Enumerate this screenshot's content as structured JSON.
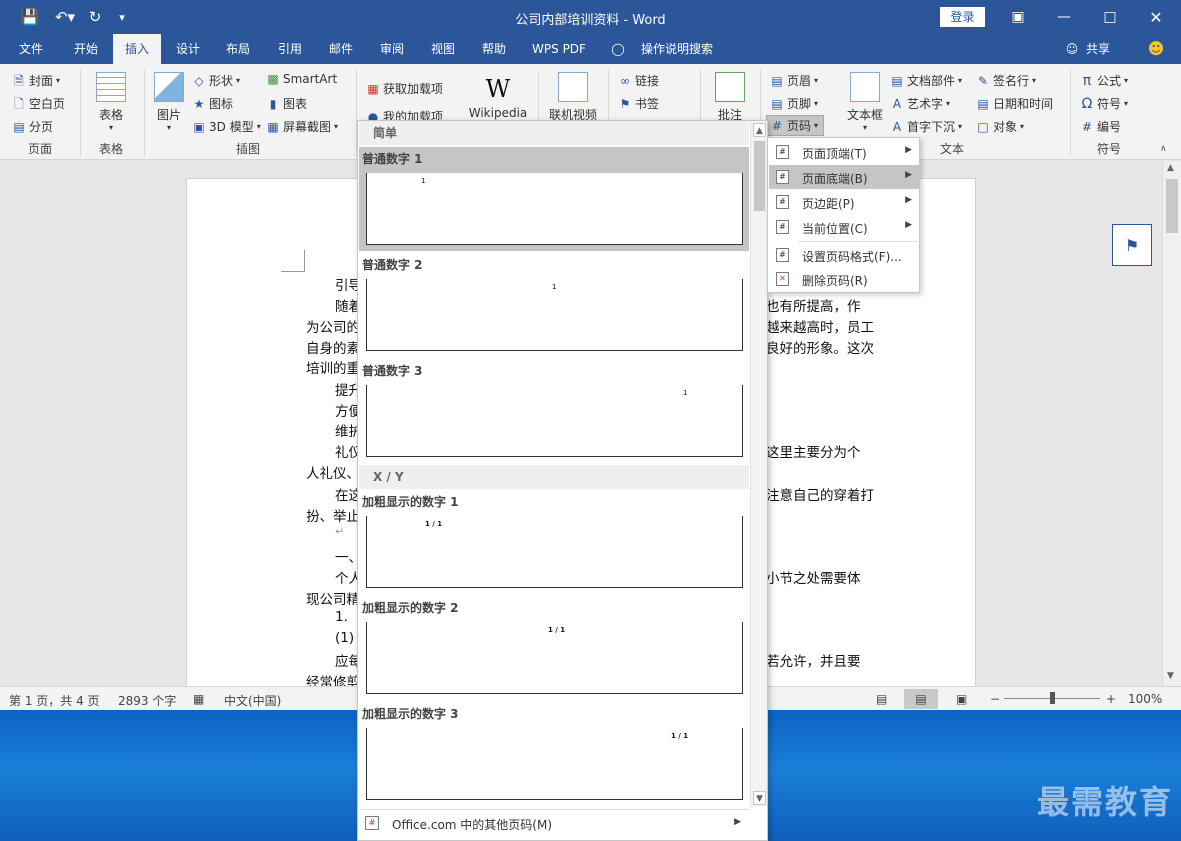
{
  "window": {
    "title": "公司内部培训资料  -  Word",
    "login_label": "登录",
    "share_label": "共享"
  },
  "tabs": [
    "文件",
    "开始",
    "插入",
    "设计",
    "布局",
    "引用",
    "邮件",
    "审阅",
    "视图",
    "帮助",
    "WPS PDF",
    "操作说明搜索"
  ],
  "ribbon": {
    "pages": {
      "cover": "封面",
      "blank": "空白页",
      "break": "分页",
      "group": "页面"
    },
    "tables": {
      "table": "表格",
      "group": "表格"
    },
    "illus": {
      "picture": "图片",
      "shapes": "形状",
      "icons": "图标",
      "model3d": "3D 模型",
      "smartart": "SmartArt",
      "chart": "图表",
      "screenshot": "屏幕截图",
      "group": "插图"
    },
    "addins": {
      "get": "获取加载项",
      "my": "我的加载项",
      "wikipedia": "Wikipedia"
    },
    "media": {
      "video": "联机视频"
    },
    "links": {
      "link": "链接",
      "bookmark": "书签"
    },
    "comments": {
      "comment": "批注"
    },
    "hf": {
      "header": "页眉",
      "footer": "页脚",
      "pagenum": "页码"
    },
    "text": {
      "textbox": "文本框",
      "parts": "文档部件",
      "wordart": "艺术字",
      "dropcap": "首字下沉",
      "signature": "签名行",
      "datetime": "日期和时间",
      "object": "对象",
      "group": "文本"
    },
    "symbols": {
      "equation": "公式",
      "symbol": "符号",
      "number": "编号",
      "group": "符号"
    }
  },
  "document": {
    "lines": [
      "引导",
      "随着",
      "为公司的",
      "自身的素",
      "培训的重",
      "提升",
      "方便",
      "维护",
      "礼仪",
      "人礼仪、",
      "在这",
      "扮、举止",
      "↵",
      "一、",
      "个人",
      "现公司精",
      "1.",
      "(1)",
      "应每",
      "经常修剪"
    ],
    "right_fragments": [
      "也有所提高，作",
      "越来越高时，员工",
      "良好的形象。这次",
      "这里主要分为个",
      "注意自己的穿着打",
      "小节之处需要体",
      "若允许，并且要"
    ]
  },
  "gallery": {
    "section1": "简单",
    "section2": "X / Y",
    "items": [
      {
        "label": "普通数字 1",
        "num": "1"
      },
      {
        "label": "普通数字 2",
        "num": "1"
      },
      {
        "label": "普通数字 3",
        "num": "1"
      },
      {
        "label": "加粗显示的数字 1",
        "num": "1 / 1"
      },
      {
        "label": "加粗显示的数字 2",
        "num": "1 / 1"
      },
      {
        "label": "加粗显示的数字 3",
        "num": "1 / 1"
      }
    ],
    "footer": "Office.com 中的其他页码(M)"
  },
  "submenu": {
    "items": [
      {
        "label": "页面顶端(T)"
      },
      {
        "label": "页面底端(B)"
      },
      {
        "label": "页边距(P)"
      },
      {
        "label": "当前位置(C)"
      },
      {
        "label": "设置页码格式(F)..."
      },
      {
        "label": "删除页码(R)"
      }
    ]
  },
  "status": {
    "page": "第 1 页，共 4 页",
    "words": "2893 个字",
    "lang": "中文(中国)",
    "zoom": "100%"
  },
  "watermark": "最需教育",
  "colors": {
    "accent": "#2b579a",
    "highlight": "#c5c5c5"
  }
}
